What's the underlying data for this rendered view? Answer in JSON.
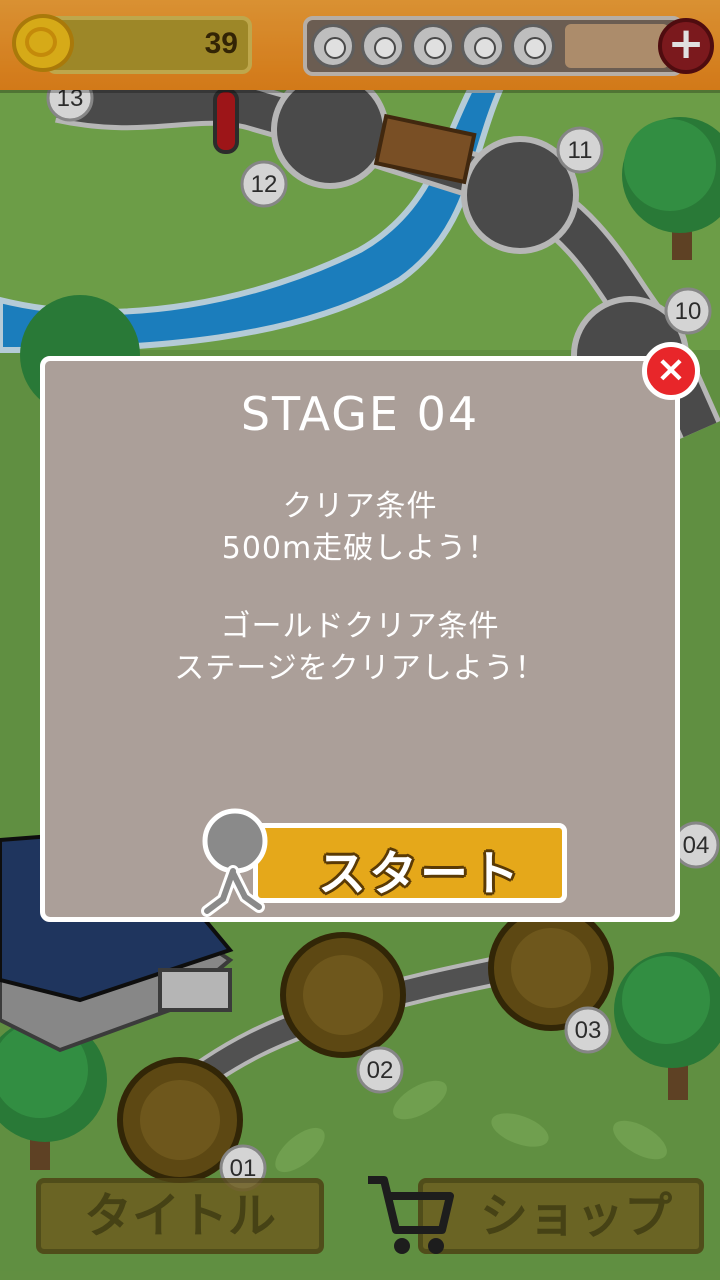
{
  "hud": {
    "coins": "39",
    "lives_count": 5,
    "add_label": "+"
  },
  "map": {
    "stage_numbers": [
      "13",
      "12",
      "11",
      "10",
      "04",
      "03",
      "02",
      "01"
    ]
  },
  "modal": {
    "title": "STAGE 04",
    "clear_condition_label": "クリア条件",
    "clear_condition_text": "500m走破しよう！",
    "gold_condition_label": "ゴールドクリア条件",
    "gold_condition_text": "ステージをクリアしよう！",
    "start_label": "スタート",
    "close_symbol": "×"
  },
  "bottom": {
    "title_label": "タイトル",
    "shop_label": "ショップ"
  },
  "colors": {
    "hud_orange": "#f08a1c",
    "modal_bg": "#ab9f99",
    "start_yellow": "#e5a81a",
    "close_red": "#e8262a",
    "grass": "#6ea34a",
    "river": "#1f8fd6"
  }
}
